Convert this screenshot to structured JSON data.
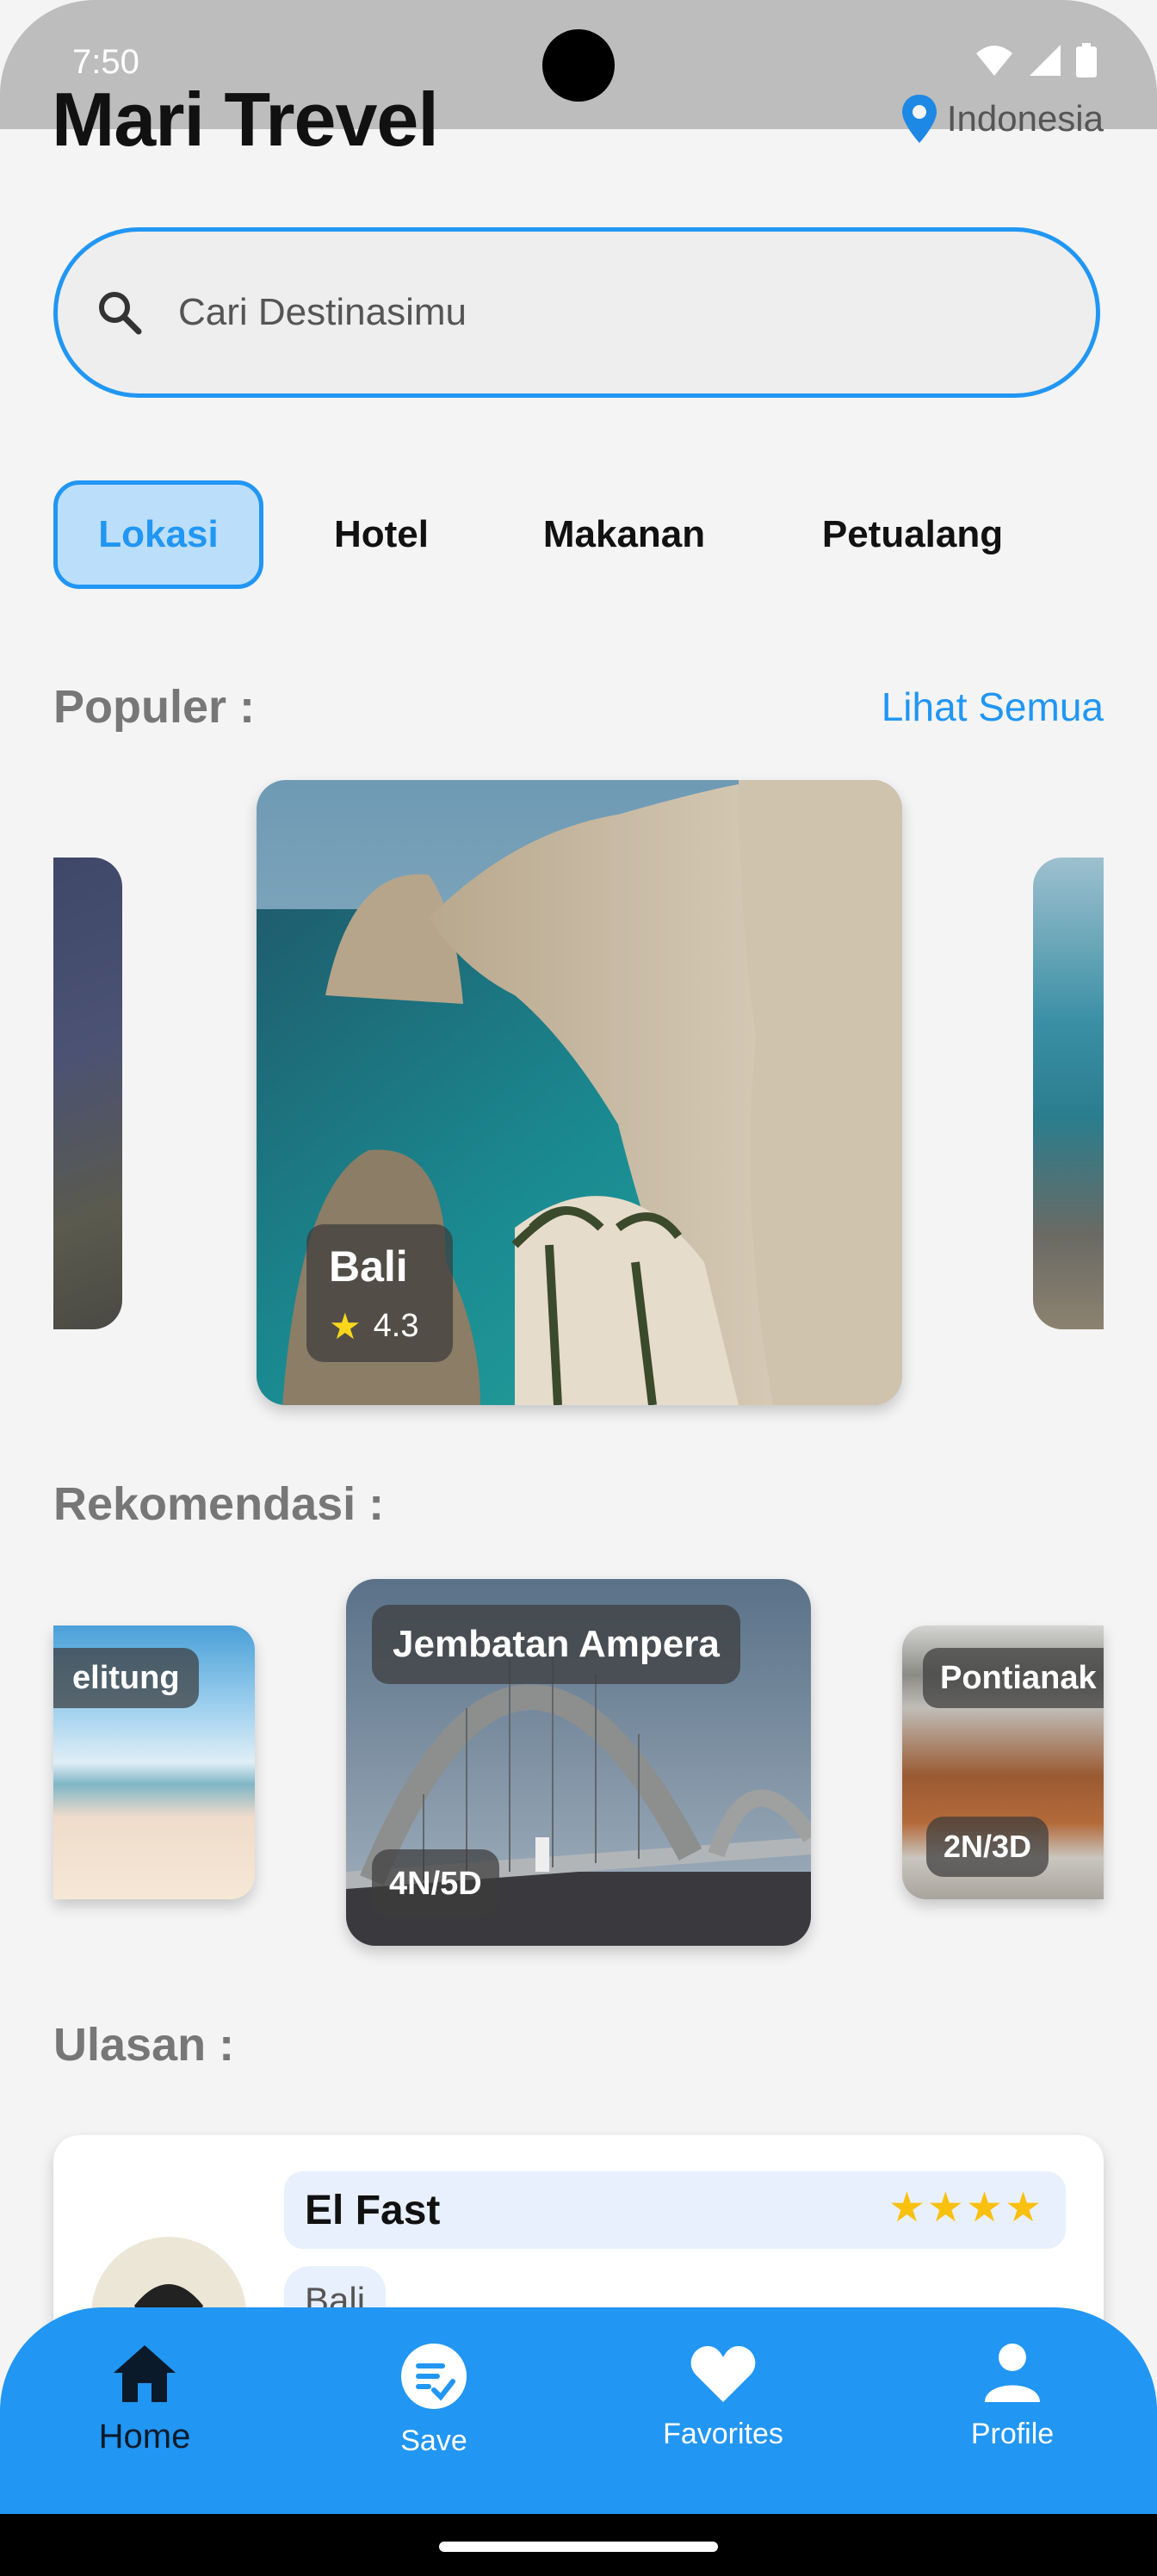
{
  "status": {
    "time": "7:50"
  },
  "app": {
    "title": "Mari Trevel",
    "location": "Indonesia"
  },
  "search": {
    "placeholder": "Cari Destinasimu"
  },
  "tabs": [
    {
      "label": "Lokasi",
      "active": true
    },
    {
      "label": "Hotel"
    },
    {
      "label": "Makanan"
    },
    {
      "label": "Petualang"
    }
  ],
  "popular": {
    "heading": "Populer :",
    "see_all": "Lihat Semua",
    "main": {
      "name": "Bali",
      "rating": "4.3"
    }
  },
  "recommend": {
    "heading": "Rekomendasi :",
    "items": [
      {
        "name": "elitung",
        "duration": ""
      },
      {
        "name": "Jembatan Ampera",
        "duration": "4N/5D"
      },
      {
        "name": "Pontianak",
        "duration": "2N/3D"
      }
    ]
  },
  "reviews": {
    "heading": "Ulasan :",
    "item": {
      "name": "El Fast",
      "place": "Bali",
      "stars": 4
    }
  },
  "nav": [
    {
      "label": "Home",
      "icon": "home-icon"
    },
    {
      "label": "Save",
      "icon": "save-check-icon"
    },
    {
      "label": "Favorites",
      "icon": "heart-icon"
    },
    {
      "label": "Profile",
      "icon": "person-icon"
    }
  ],
  "colors": {
    "accent": "#2196f3",
    "star": "#f9c00d",
    "tab_active_bg": "#bbdefb"
  }
}
